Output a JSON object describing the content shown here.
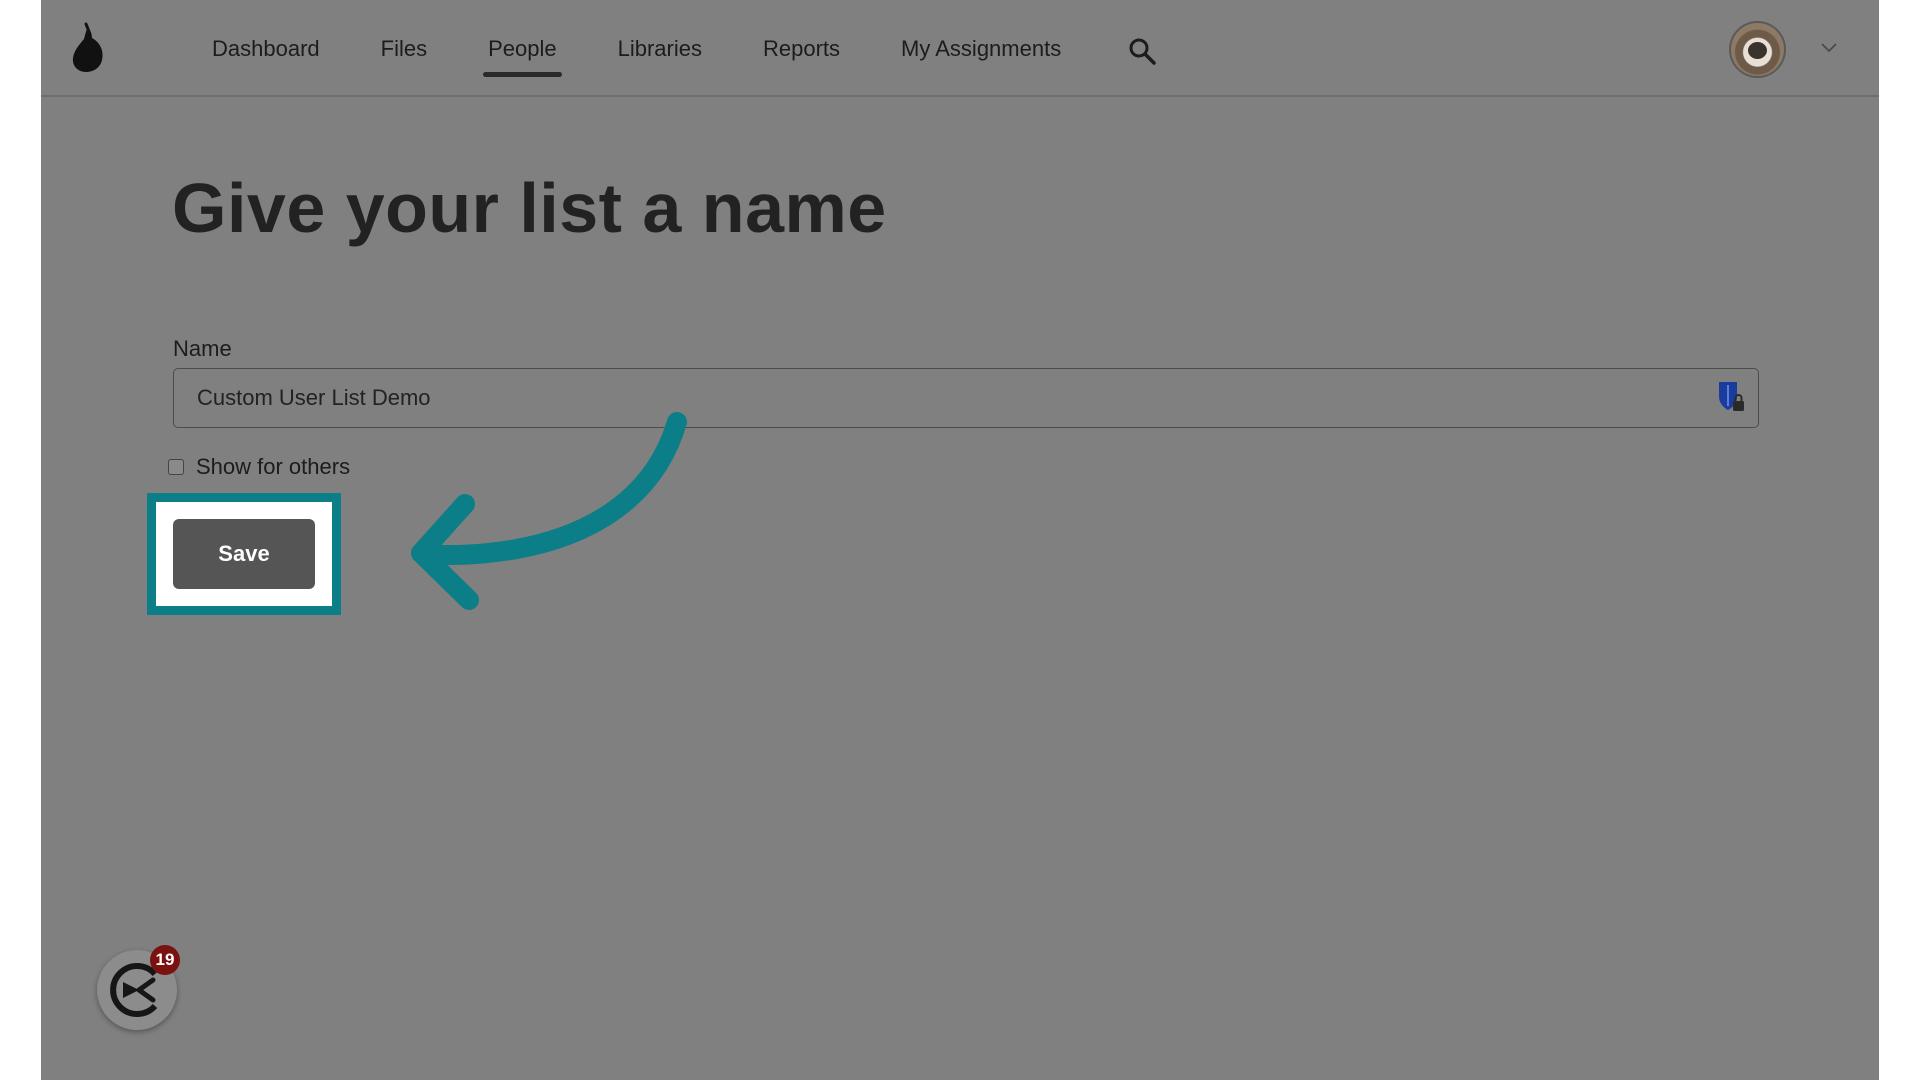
{
  "nav": {
    "items": [
      {
        "label": "Dashboard",
        "active": false
      },
      {
        "label": "Files",
        "active": false
      },
      {
        "label": "People",
        "active": true
      },
      {
        "label": "Libraries",
        "active": false
      },
      {
        "label": "Reports",
        "active": false
      },
      {
        "label": "My Assignments",
        "active": false
      }
    ],
    "icons": {
      "logo": "pear-logo-icon",
      "search": "search-icon",
      "caret": "chevron-down-icon"
    }
  },
  "main": {
    "title": "Give your list a name",
    "name_label": "Name",
    "name_value": "Custom User List Demo",
    "show_for_others_label": "Show for others",
    "show_for_others_checked": false,
    "save_label": "Save"
  },
  "widget": {
    "badge_count": "19",
    "icon": "helper-widget-icon"
  },
  "colors": {
    "overlay": "#808080",
    "highlight": "#0b7e88",
    "save_button": "#555555",
    "badge": "#7a1212",
    "password_manager": "#1a3c9e"
  }
}
